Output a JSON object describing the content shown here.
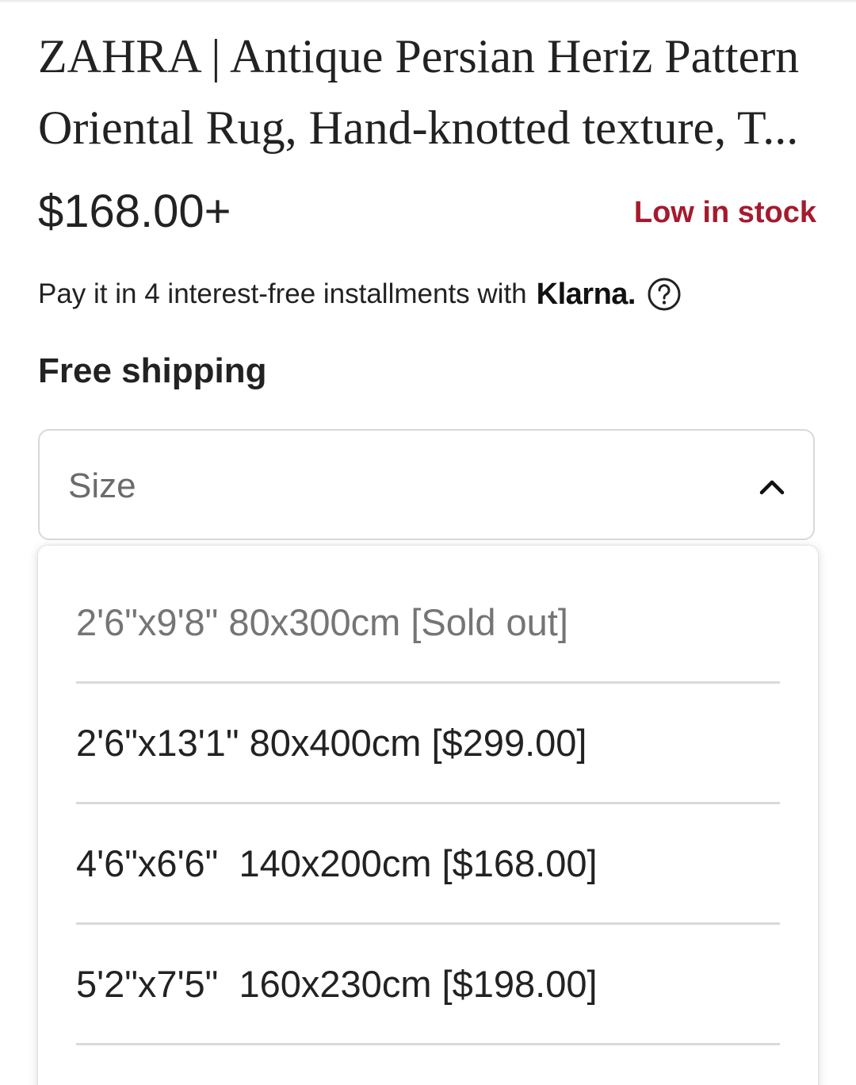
{
  "product": {
    "title": "ZAHRA | Antique Persian Heriz Pattern Oriental Rug, Hand-knotted texture, T...",
    "price": "$168.00+",
    "stock_status": "Low in stock",
    "installments_text": "Pay it in 4 interest-free installments with",
    "klarna_logo": "Klarna.",
    "shipping": "Free shipping"
  },
  "size_select": {
    "label": "Size",
    "expanded": true,
    "options": [
      {
        "label": "2'6\"x9'8\" 80x300cm [Sold out]",
        "disabled": true
      },
      {
        "label": "2'6\"x13'1\" 80x400cm [$299.00]",
        "disabled": false
      },
      {
        "label": "4'6\"x6'6\"  140x200cm [$168.00]",
        "disabled": false
      },
      {
        "label": "5'2\"x7'5\"  160x230cm [$198.00]",
        "disabled": false
      }
    ]
  },
  "colors": {
    "stock_accent": "#a61a2e",
    "text": "#222222",
    "muted": "#757575",
    "border": "#d9d9d9"
  },
  "icons": {
    "help": "question-circle-icon",
    "chevron": "chevron-up-icon"
  }
}
